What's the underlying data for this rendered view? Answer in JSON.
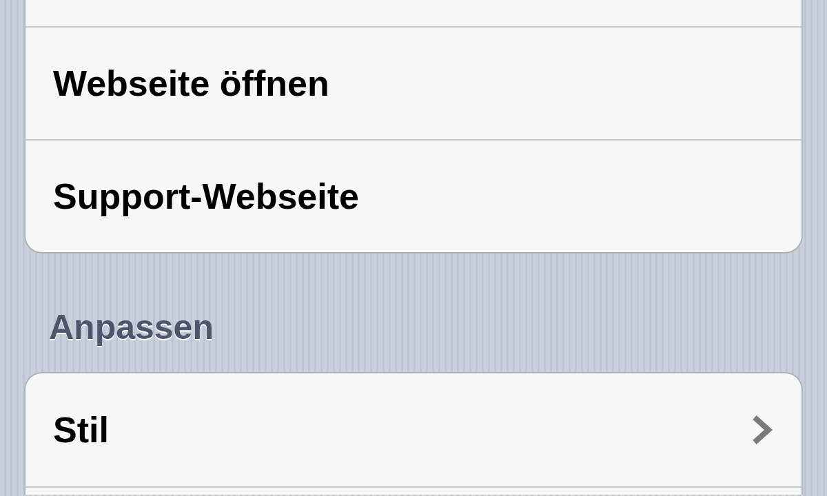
{
  "groups": [
    {
      "rows": [
        {
          "label": "Webseite öffnen",
          "chevron": false
        },
        {
          "label": "Support-Webseite",
          "chevron": false
        }
      ]
    },
    {
      "header": "Anpassen",
      "rows": [
        {
          "label": "Stil",
          "chevron": true
        }
      ]
    }
  ]
}
